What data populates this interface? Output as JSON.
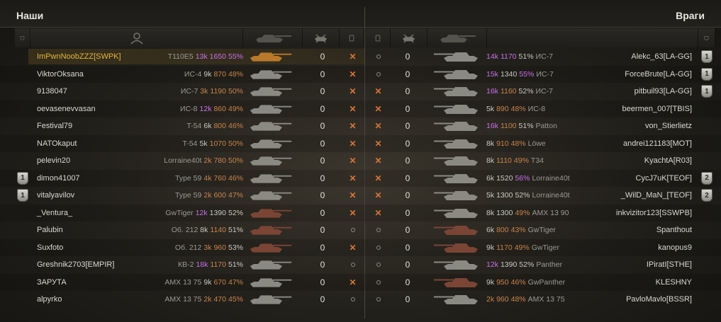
{
  "allies": {
    "title": "Наши",
    "players": [
      {
        "name": "ImPwnNoobZZZ[SWPK]",
        "tank": "T110E5",
        "battles": "13k",
        "wn": "1650",
        "pct": "55%",
        "frags": "0",
        "status": "destroyed",
        "tank_color": "#b87a2a",
        "self": true,
        "badge": "",
        "type_color": "#9a9a92",
        "battles_color": "#c870e8",
        "wn_color": "#c870e8",
        "pct_color": "#c870e8"
      },
      {
        "name": "ViktorOksana",
        "tank": "ИС-4",
        "battles": "9k",
        "wn": "870",
        "pct": "48%",
        "frags": "0",
        "status": "destroyed",
        "tank_color": "#8a8a82",
        "badge": "",
        "type_color": "#9a9a92",
        "battles_color": "#c9c9c1",
        "wn_color": "#c9834b",
        "pct_color": "#c9834b"
      },
      {
        "name": "9138047",
        "tank": "ИС-7",
        "battles": "3k",
        "wn": "1190",
        "pct": "50%",
        "frags": "0",
        "status": "destroyed",
        "tank_color": "#8a8a82",
        "badge": "",
        "type_color": "#9a9a92",
        "battles_color": "#c9834b",
        "wn_color": "#c9834b",
        "pct_color": "#c9834b"
      },
      {
        "name": "oevasenevvasan",
        "tank": "ИС-8",
        "battles": "12k",
        "wn": "860",
        "pct": "49%",
        "frags": "0",
        "status": "destroyed",
        "tank_color": "#8a8a82",
        "badge": "",
        "type_color": "#9a9a92",
        "battles_color": "#c870e8",
        "wn_color": "#c9834b",
        "pct_color": "#c9834b"
      },
      {
        "name": "Festival79",
        "tank": "T-54",
        "battles": "6k",
        "wn": "800",
        "pct": "46%",
        "frags": "0",
        "status": "destroyed",
        "tank_color": "#8a8a82",
        "badge": "",
        "type_color": "#9a9a92",
        "battles_color": "#c9c9c1",
        "wn_color": "#c9834b",
        "pct_color": "#c9834b"
      },
      {
        "name": "NATOkaput",
        "tank": "T-54",
        "battles": "5k",
        "wn": "1070",
        "pct": "50%",
        "frags": "0",
        "status": "destroyed",
        "tank_color": "#8a8a82",
        "badge": "",
        "type_color": "#9a9a92",
        "battles_color": "#c9c9c1",
        "wn_color": "#c9834b",
        "pct_color": "#c9834b"
      },
      {
        "name": "pelevin20",
        "tank": "Lorraine40t",
        "battles": "2k",
        "wn": "780",
        "pct": "50%",
        "frags": "0",
        "status": "destroyed",
        "tank_color": "#8a8a82",
        "badge": "",
        "type_color": "#9a9a92",
        "battles_color": "#c9834b",
        "wn_color": "#c9834b",
        "pct_color": "#c9834b"
      },
      {
        "name": "dimon41007",
        "tank": "Type 59",
        "battles": "4k",
        "wn": "760",
        "pct": "46%",
        "frags": "0",
        "status": "destroyed",
        "tank_color": "#8a8a82",
        "badge": "",
        "type_color": "#9a9a92",
        "battles_color": "#c9834b",
        "wn_color": "#c9834b",
        "pct_color": "#c9834b",
        "rank": "1"
      },
      {
        "name": "vitalyavilov",
        "tank": "Type 59",
        "battles": "2k",
        "wn": "600",
        "pct": "47%",
        "frags": "0",
        "status": "destroyed",
        "tank_color": "#8a8a82",
        "badge": "",
        "type_color": "#9a9a92",
        "battles_color": "#c9834b",
        "wn_color": "#c9834b",
        "pct_color": "#c9834b",
        "rank": "1"
      },
      {
        "name": "_Ventura_",
        "tank": "GwTiger",
        "battles": "12k",
        "wn": "1390",
        "pct": "52%",
        "frags": "0",
        "status": "destroyed",
        "tank_color": "#7a4535",
        "badge": "",
        "type_color": "#9a9a92",
        "battles_color": "#c870e8",
        "wn_color": "#c9c9c1",
        "pct_color": "#c9c9c1"
      },
      {
        "name": "Palubin",
        "tank": "Об. 212",
        "battles": "8k",
        "wn": "1140",
        "pct": "51%",
        "frags": "0",
        "status": "alive",
        "tank_color": "#7a4535",
        "badge": "",
        "type_color": "#9a9a92",
        "battles_color": "#c9c9c1",
        "wn_color": "#c9834b",
        "pct_color": "#c9c9c1"
      },
      {
        "name": "Suxfoto",
        "tank": "Об. 212",
        "battles": "3k",
        "wn": "960",
        "pct": "53%",
        "frags": "0",
        "status": "destroyed",
        "tank_color": "#7a4535",
        "badge": "",
        "type_color": "#9a9a92",
        "battles_color": "#c9834b",
        "wn_color": "#c9834b",
        "pct_color": "#c9c9c1"
      },
      {
        "name": "Greshnik2703[EMPIR]",
        "tank": "КВ-2",
        "battles": "18k",
        "wn": "1170",
        "pct": "51%",
        "frags": "0",
        "status": "alive",
        "tank_color": "#8a8a82",
        "badge": "",
        "type_color": "#9a9a92",
        "battles_color": "#c870e8",
        "wn_color": "#c9834b",
        "pct_color": "#c9c9c1"
      },
      {
        "name": "ЗАРУТА",
        "tank": "AMX 13 75",
        "battles": "9k",
        "wn": "670",
        "pct": "47%",
        "frags": "0",
        "status": "destroyed",
        "tank_color": "#8a8a82",
        "badge": "",
        "type_color": "#9a9a92",
        "battles_color": "#c9c9c1",
        "wn_color": "#c9834b",
        "pct_color": "#c9834b"
      },
      {
        "name": "alpyrko",
        "tank": "AMX 13 75",
        "battles": "2k",
        "wn": "470",
        "pct": "45%",
        "frags": "0",
        "status": "alive",
        "tank_color": "#8a8a82",
        "badge": "",
        "type_color": "#9a9a92",
        "battles_color": "#c9834b",
        "wn_color": "#c9834b",
        "pct_color": "#c9834b"
      }
    ]
  },
  "enemies": {
    "title": "Враги",
    "players": [
      {
        "name": "Alekc_63[LA-GG]",
        "tank": "ИС-7",
        "battles": "14k",
        "wn": "1170",
        "pct": "51%",
        "frags": "0",
        "status": "alive",
        "tank_color": "#8a8a82",
        "battles_color": "#c870e8",
        "wn_color": "#c870e8",
        "pct_color": "#c9c9c1",
        "rank": "1"
      },
      {
        "name": "ForceBrute[LA-GG]",
        "tank": "ИС-7",
        "battles": "15k",
        "wn": "1340",
        "pct": "55%",
        "frags": "0",
        "status": "alive",
        "tank_color": "#8a8a82",
        "battles_color": "#c870e8",
        "wn_color": "#c9c9c1",
        "pct_color": "#c870e8",
        "rank": "1"
      },
      {
        "name": "pitbuil93[LA-GG]",
        "tank": "ИС-7",
        "battles": "16k",
        "wn": "1160",
        "pct": "52%",
        "frags": "0",
        "status": "destroyed",
        "tank_color": "#8a8a82",
        "battles_color": "#c870e8",
        "wn_color": "#c9834b",
        "pct_color": "#c9c9c1",
        "rank": "1"
      },
      {
        "name": "beermen_007[TBIS]",
        "tank": "ИС-8",
        "battles": "5k",
        "wn": "890",
        "pct": "48%",
        "frags": "0",
        "status": "destroyed",
        "tank_color": "#8a8a82",
        "battles_color": "#c9c9c1",
        "wn_color": "#c9834b",
        "pct_color": "#c9834b"
      },
      {
        "name": "von_Stierlietz",
        "tank": "Patton",
        "battles": "16k",
        "wn": "1100",
        "pct": "51%",
        "frags": "0",
        "status": "destroyed",
        "tank_color": "#8a8a82",
        "battles_color": "#c870e8",
        "wn_color": "#c9834b",
        "pct_color": "#c9c9c1"
      },
      {
        "name": "andrei121183[MOT]",
        "tank": "Löwe",
        "battles": "8k",
        "wn": "910",
        "pct": "48%",
        "frags": "0",
        "status": "destroyed",
        "tank_color": "#8a8a82",
        "battles_color": "#c9c9c1",
        "wn_color": "#c9834b",
        "pct_color": "#c9834b"
      },
      {
        "name": "KyachtA[R03]",
        "tank": "T34",
        "battles": "8k",
        "wn": "1110",
        "pct": "49%",
        "frags": "0",
        "status": "destroyed",
        "tank_color": "#8a8a82",
        "battles_color": "#c9c9c1",
        "wn_color": "#c9834b",
        "pct_color": "#c9834b"
      },
      {
        "name": "CycJ7uK[TEOF]",
        "tank": "Lorraine40t",
        "battles": "6k",
        "wn": "1520",
        "pct": "56%",
        "frags": "0",
        "status": "destroyed",
        "tank_color": "#8a8a82",
        "battles_color": "#c9c9c1",
        "wn_color": "#c9c9c1",
        "pct_color": "#c870e8",
        "rank": "2"
      },
      {
        "name": "_WilD_MaN_[TEOF]",
        "tank": "Lorraine40t",
        "battles": "5k",
        "wn": "1300",
        "pct": "52%",
        "frags": "0",
        "status": "destroyed",
        "tank_color": "#8a8a82",
        "battles_color": "#c9c9c1",
        "wn_color": "#c9c9c1",
        "pct_color": "#c9c9c1",
        "rank": "2"
      },
      {
        "name": "inkvizitor123[SSWPB]",
        "tank": "AMX 13 90",
        "battles": "8k",
        "wn": "1300",
        "pct": "49%",
        "frags": "0",
        "status": "destroyed",
        "tank_color": "#8a8a82",
        "battles_color": "#c9c9c1",
        "wn_color": "#c9c9c1",
        "pct_color": "#c9834b"
      },
      {
        "name": "Spanthout",
        "tank": "GwTiger",
        "battles": "6k",
        "wn": "800",
        "pct": "43%",
        "frags": "0",
        "status": "alive",
        "tank_color": "#7a4535",
        "battles_color": "#c9c9c1",
        "wn_color": "#c9834b",
        "pct_color": "#c9834b"
      },
      {
        "name": "kanopus9",
        "tank": "GwTiger",
        "battles": "9k",
        "wn": "1170",
        "pct": "49%",
        "frags": "0",
        "status": "alive",
        "tank_color": "#7a4535",
        "battles_color": "#c9c9c1",
        "wn_color": "#c9834b",
        "pct_color": "#c9834b"
      },
      {
        "name": "IPiratI[STHE]",
        "tank": "Panther",
        "battles": "12k",
        "wn": "1390",
        "pct": "52%",
        "frags": "0",
        "status": "alive",
        "tank_color": "#8a8a82",
        "battles_color": "#c870e8",
        "wn_color": "#c9c9c1",
        "pct_color": "#c9c9c1"
      },
      {
        "name": "KLESHNY",
        "tank": "GwPanther",
        "battles": "9k",
        "wn": "950",
        "pct": "46%",
        "frags": "0",
        "status": "alive",
        "tank_color": "#7a4535",
        "battles_color": "#c9c9c1",
        "wn_color": "#c9834b",
        "pct_color": "#c9834b"
      },
      {
        "name": "PavloMavlo[BSSR]",
        "tank": "AMX 13 75",
        "battles": "2k",
        "wn": "960",
        "pct": "48%",
        "frags": "0",
        "status": "alive",
        "tank_color": "#8a8a82",
        "battles_color": "#c9834b",
        "wn_color": "#c9834b",
        "pct_color": "#c9834b"
      }
    ]
  }
}
